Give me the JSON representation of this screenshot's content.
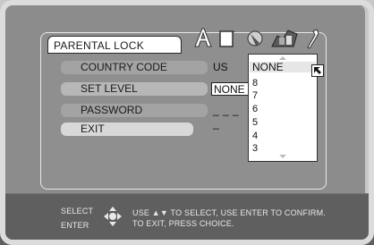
{
  "menu": {
    "title": "PARENTAL LOCK",
    "items": [
      {
        "label": "COUNTRY CODE",
        "value": "US"
      },
      {
        "label": "SET LEVEL",
        "value": "NONE"
      },
      {
        "label": "PASSWORD",
        "value": "_ _ _ _"
      },
      {
        "label": "EXIT",
        "value": ""
      }
    ]
  },
  "tab_icons": [
    "audio-a-icon",
    "screen-icon",
    "speaker-icon",
    "parental-icon",
    "settings-wrench-icon"
  ],
  "dropdown": {
    "selected": "NONE",
    "options": [
      "8",
      "7",
      "6",
      "5",
      "4",
      "3"
    ]
  },
  "help": {
    "select_label": "SELECT",
    "enter_label": "ENTER",
    "line1": "USE ▲▼ TO SELECT,  USE ENTER TO CONFIRM.",
    "line2": "TO EXIT, PRESS CHOICE."
  }
}
